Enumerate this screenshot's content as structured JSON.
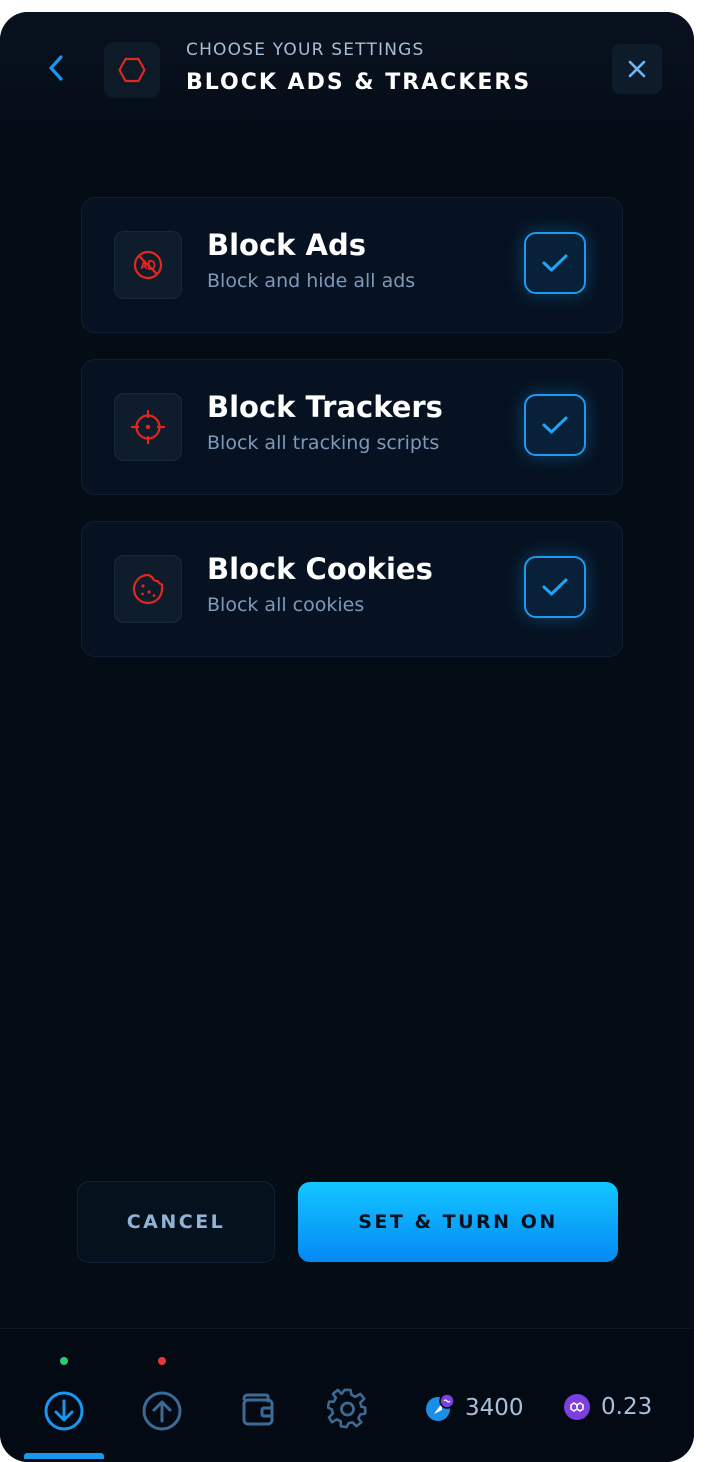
{
  "header": {
    "subtitle": "CHOOSE YOUR SETTINGS",
    "title": "BLOCK ADS & TRACKERS"
  },
  "options": [
    {
      "title": "Block Ads",
      "description": "Block and hide all ads",
      "checked": true,
      "icon": "no-ads-icon"
    },
    {
      "title": "Block Trackers",
      "description": "Block all tracking scripts",
      "checked": true,
      "icon": "crosshair-icon"
    },
    {
      "title": "Block Cookies",
      "description": "Block all cookies",
      "checked": true,
      "icon": "cookie-icon"
    }
  ],
  "actions": {
    "cancel_label": "CANCEL",
    "primary_label": "SET & TURN ON"
  },
  "nav": {
    "items": [
      "download-icon",
      "upload-icon",
      "wallet-icon",
      "gear-icon"
    ],
    "download_status_color": "#2ecc71",
    "upload_status_color": "#e53935"
  },
  "balances": {
    "points": "3400",
    "token": "0.23"
  },
  "colors": {
    "accent": "#1996ee",
    "danger": "#e0281e",
    "background": "#040c16"
  }
}
